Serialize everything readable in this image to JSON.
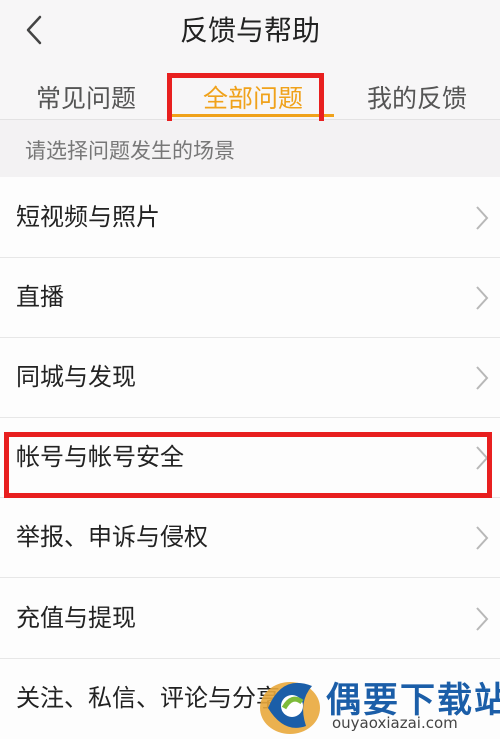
{
  "header": {
    "title": "反馈与帮助",
    "back_icon": "chevron-left-icon"
  },
  "tabs": [
    {
      "label": "常见问题",
      "active": false
    },
    {
      "label": "全部问题",
      "active": true
    },
    {
      "label": "我的反馈",
      "active": false
    }
  ],
  "hint": "请选择问题发生的场景",
  "list": {
    "items": [
      {
        "label": "短视频与照片"
      },
      {
        "label": "直播"
      },
      {
        "label": "同城与发现"
      },
      {
        "label": "帐号与帐号安全"
      },
      {
        "label": "举报、申诉与侵权"
      },
      {
        "label": "充值与提现"
      },
      {
        "label": "关注、私信、评论与分享"
      }
    ],
    "chevron_icon": "chevron-right-icon"
  },
  "colors": {
    "accent": "#f0a21b",
    "highlight_box": "#e81f1f",
    "watermark": "#1b5ea8"
  },
  "watermark": {
    "title": "偶要下载站",
    "subtitle": "ouyaoxiazai.com"
  }
}
